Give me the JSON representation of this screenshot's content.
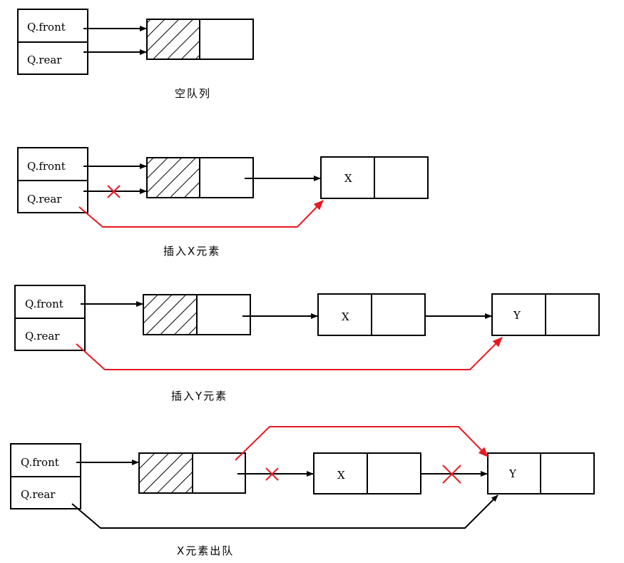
{
  "colors": {
    "pointer": "#000000",
    "change": "#e8191f"
  },
  "labels": {
    "front": "Q.front",
    "rear": "Q.rear"
  },
  "panels": [
    {
      "caption": "空队列",
      "nodes": []
    },
    {
      "caption": "插入X元素",
      "nodes": [
        "X"
      ]
    },
    {
      "caption": "插入Y元素",
      "nodes": [
        "X",
        "Y"
      ]
    },
    {
      "caption": "X元素出队",
      "nodes": [
        "X",
        "Y"
      ]
    }
  ]
}
